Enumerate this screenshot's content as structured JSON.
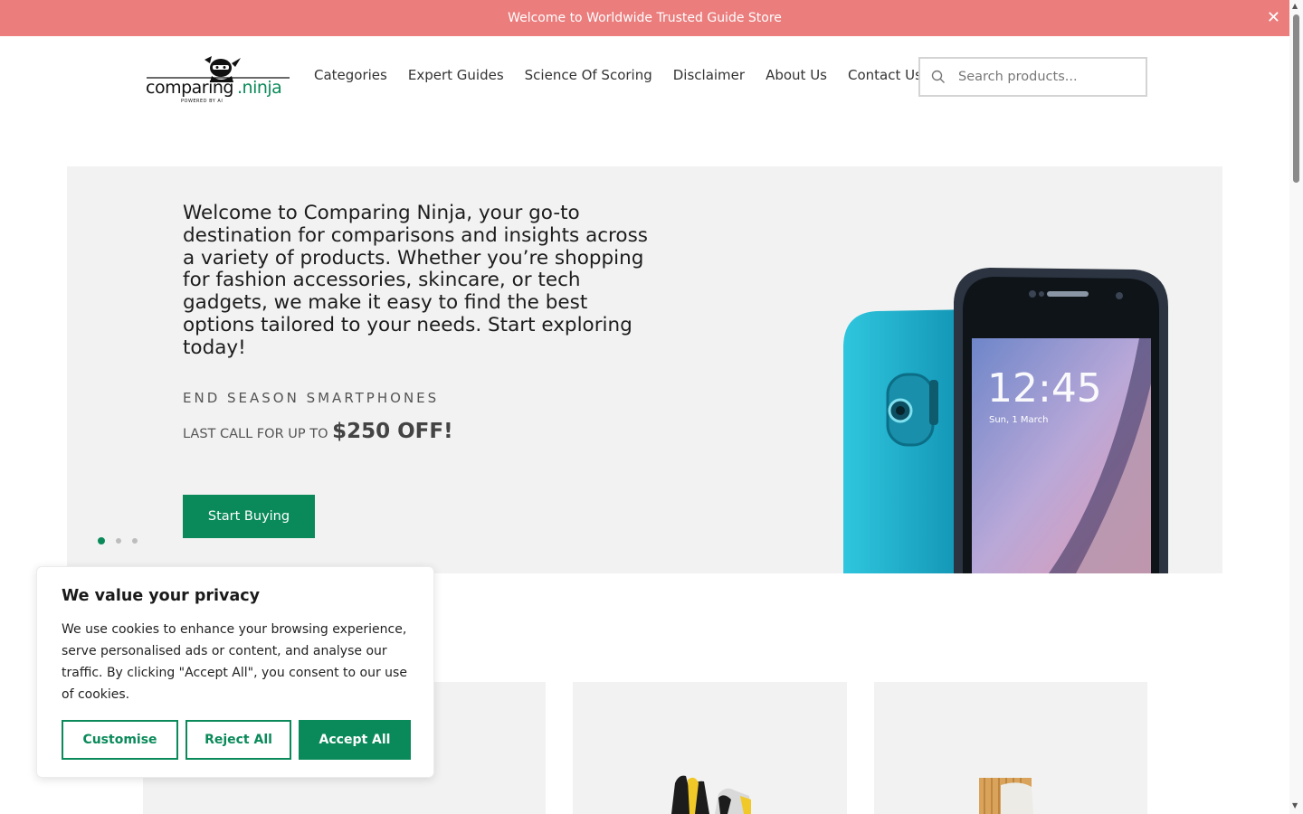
{
  "announcement": {
    "text": "Welcome to Worldwide Trusted Guide Store",
    "close_icon": "close-icon"
  },
  "header": {
    "logo_text": "comparing.ninja",
    "logo_tagline": "POWERED BY AI",
    "nav": [
      "Categories",
      "Expert Guides",
      "Science Of Scoring",
      "Disclaimer",
      "About Us",
      "Contact Us"
    ],
    "search_placeholder": "Search products..."
  },
  "hero": {
    "title": "Welcome to Comparing Ninja, your go-to destination for comparisons and insights across a variety of products. Whether you’re shopping for fashion accessories, skincare, or tech gadgets, we make it easy to find the best options tailored to your needs. Start exploring today!",
    "subtitle": "END SEASON SMARTPHONES",
    "promo_prefix": "LAST CALL FOR UP TO",
    "promo_highlight": "$250 OFF!",
    "button": "Start Buying",
    "slides": 3,
    "active_slide": 1,
    "phone_time": "12:45",
    "phone_date": "Sun, 1 March"
  },
  "cookie_banner": {
    "title": "We value your privacy",
    "text": "We use cookies to enhance your browsing experience, serve personalised ads or content, and analyse our traffic. By clicking \"Accept All\", you consent to our use of cookies.",
    "buttons": {
      "customise": "Customise",
      "reject": "Reject All",
      "accept": "Accept All"
    }
  },
  "colors": {
    "accent": "#0a8a5a",
    "announcement_bg": "#eb7d7d",
    "panel_bg": "#f2f2f2"
  }
}
